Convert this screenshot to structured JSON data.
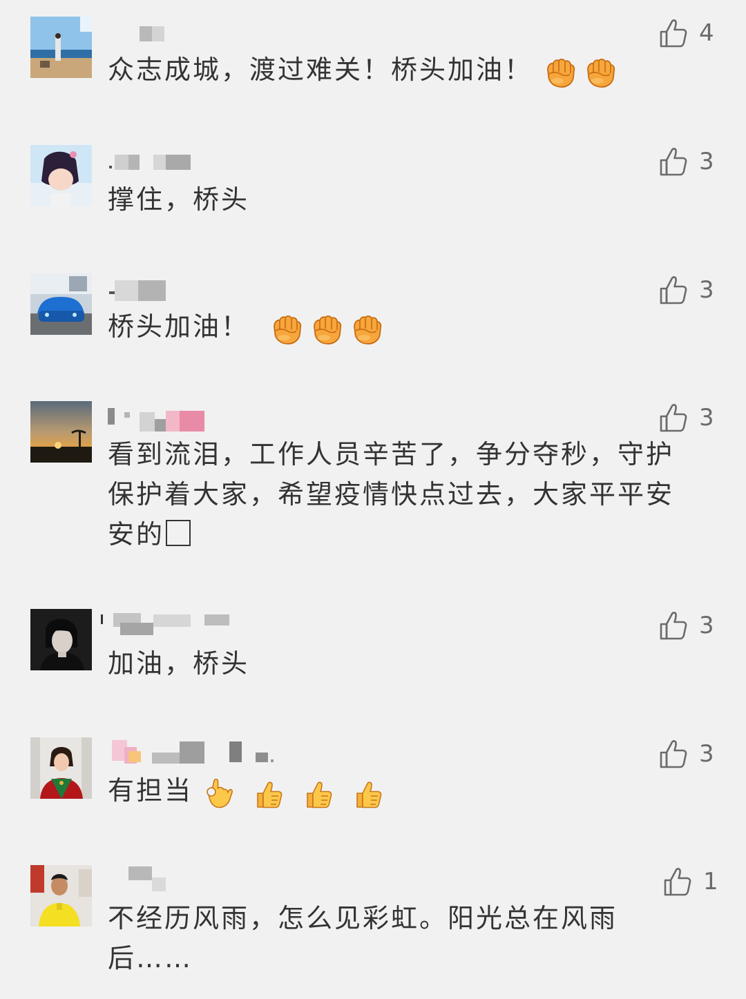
{
  "comments": [
    {
      "text": "众志成城，渡过难关！桥头加油！",
      "likes": "4",
      "emoji": [
        "raised-fist",
        "raised-fist"
      ]
    },
    {
      "text": "撑住，桥头",
      "likes": "3",
      "emoji": []
    },
    {
      "text": "桥头加油！",
      "likes": "3",
      "emoji": [
        "raised-fist",
        "raised-fist",
        "raised-fist"
      ]
    },
    {
      "text_line1": "看到流泪，工作人员辛苦了，争分夺秒，守护",
      "text_line2": "保护着大家，希望疫情快点过去，大家平平安",
      "text_line3": "安的",
      "likes": "3",
      "emoji": []
    },
    {
      "text": "加油，桥头",
      "likes": "3",
      "emoji": []
    },
    {
      "text": "有担当",
      "likes": "3",
      "emoji": [
        "ok-hand",
        "thumbs-up",
        "thumbs-up",
        "thumbs-up"
      ]
    },
    {
      "text_line1": "不经历风雨，怎么见彩虹。阳光总在风雨",
      "text_line2": "后……",
      "likes": "1",
      "emoji": []
    }
  ],
  "icons": {
    "like": "thumbs-up-outline-icon"
  },
  "colors": {
    "background": "#f1f1f1",
    "text": "#333333",
    "like_icon": "#6a6a6a",
    "emoji_orange": "#f7a63b"
  }
}
